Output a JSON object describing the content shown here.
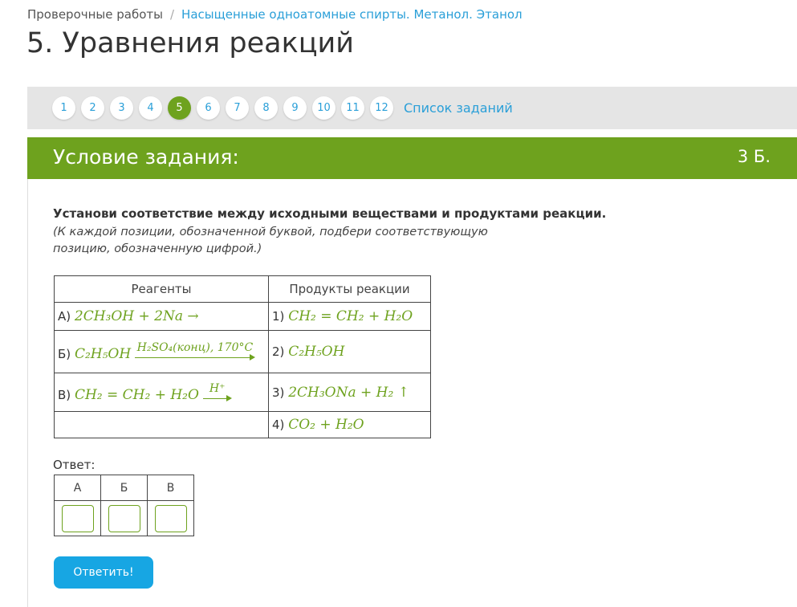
{
  "breadcrumb": {
    "root": "Проверочные работы",
    "separator": "/",
    "current": "Насыщенные одноатомные спирты. Метанол. Этанол"
  },
  "page_title": "5. Уравнения реакций",
  "pager": {
    "pages": [
      "1",
      "2",
      "3",
      "4",
      "5",
      "6",
      "7",
      "8",
      "9",
      "10",
      "11",
      "12"
    ],
    "active": "5",
    "list_link": "Список заданий"
  },
  "task": {
    "header": "Условие задания:",
    "points": "3 Б.",
    "instruction": "Установи соответствие между исходными веществами и продуктами реакции.",
    "hint": "(К каждой позиции, обозначенной буквой, подбери соответствующую позицию, обозначенную цифрой.)"
  },
  "match_table": {
    "col_reagents": "Реагенты",
    "col_products": "Продукты реакции",
    "reagents": [
      {
        "label": "А)",
        "formula": "2CH₃OH + 2Na →"
      },
      {
        "label": "Б)",
        "formula": "C₂H₅OH",
        "condition": "H₂SO₄(конц), 170°C"
      },
      {
        "label": "В)",
        "formula": "CH₂ = CH₂ + H₂O",
        "condition": "H⁺"
      }
    ],
    "products": [
      {
        "label": "1)",
        "formula": "CH₂ = CH₂ + H₂O"
      },
      {
        "label": "2)",
        "formula": "C₂H₅OH"
      },
      {
        "label": "3)",
        "formula": "2CH₃ONa + H₂ ↑"
      },
      {
        "label": "4)",
        "formula": "CO₂ + H₂O"
      }
    ]
  },
  "answer": {
    "label": "Ответ:",
    "columns": [
      "А",
      "Б",
      "В"
    ],
    "values": [
      "",
      "",
      ""
    ]
  },
  "submit_label": "Ответить!",
  "colors": {
    "accent_green": "#6ea21e",
    "link_blue": "#2a9fd8",
    "button_blue": "#17a6e3"
  }
}
